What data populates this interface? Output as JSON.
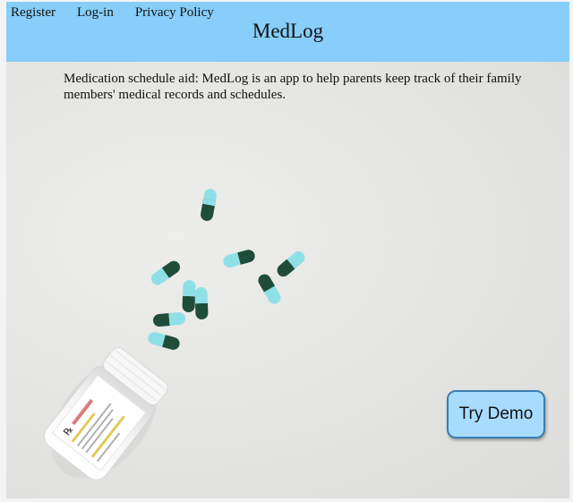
{
  "nav": {
    "register": "Register",
    "login": "Log-in",
    "privacy": "Privacy Policy"
  },
  "header": {
    "title": "MedLog"
  },
  "main": {
    "description": "Medication schedule aid: MedLog is an app to help parents keep track of their family members' medical records and schedules.",
    "demo_button": "Try Demo"
  },
  "colors": {
    "header_bg": "#87cefa",
    "button_bg": "#a8dcff",
    "capsule_dark": "#1f4d3a",
    "capsule_light": "#8fe0e6"
  }
}
